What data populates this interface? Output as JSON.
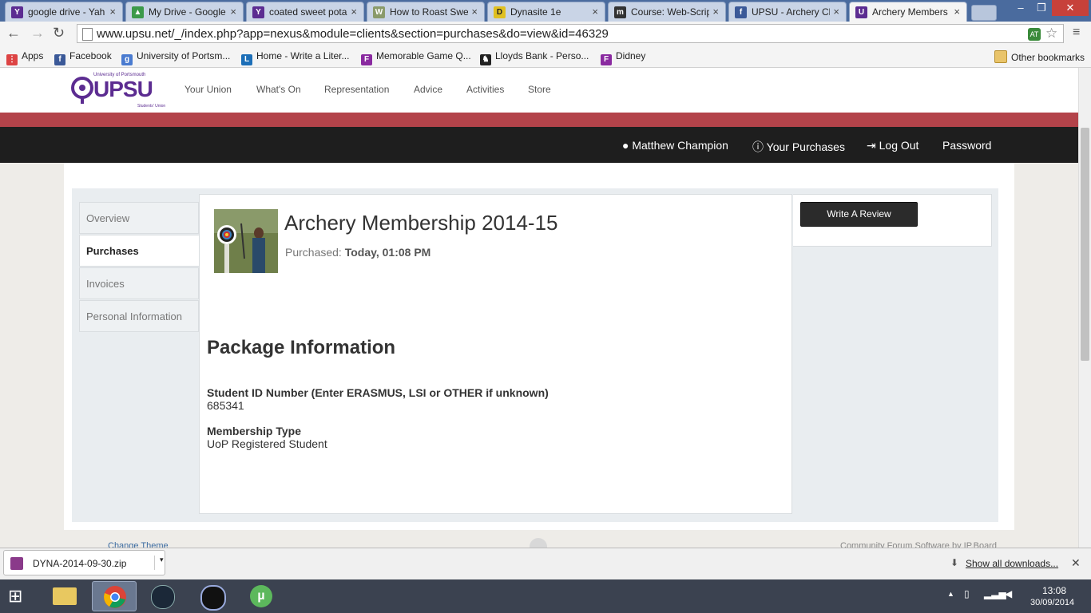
{
  "browser": {
    "tabs": [
      {
        "label": "google drive - Yah",
        "icon_letter": "Y",
        "icon_color": "#5c2c91"
      },
      {
        "label": "My Drive - Google",
        "icon_letter": "▲",
        "icon_color": "#3c9a4a"
      },
      {
        "label": "coated sweet pota",
        "icon_letter": "Y",
        "icon_color": "#5c2c91"
      },
      {
        "label": "How to Roast Swe",
        "icon_letter": "W",
        "icon_color": "#8a9a6a"
      },
      {
        "label": "Dynasite 1e",
        "icon_letter": "D",
        "icon_color": "#e0c020"
      },
      {
        "label": "Course: Web-Scrip",
        "icon_letter": "m",
        "icon_color": "#333333"
      },
      {
        "label": "UPSU - Archery Cl",
        "icon_letter": "f",
        "icon_color": "#3b5998"
      },
      {
        "label": "Archery Members",
        "icon_letter": "U",
        "icon_color": "#5c2c91"
      }
    ],
    "url": "www.upsu.net/_/index.php?app=nexus&module=clients&section=purchases&do=view&id=46329",
    "bookmarks": [
      {
        "label": "Apps",
        "icon_color": "#d44"
      },
      {
        "label": "Facebook",
        "icon_color": "#3b5998"
      },
      {
        "label": "University of Portsm...",
        "icon_color": "#4a7bd0"
      },
      {
        "label": "Home - Write a Liter...",
        "icon_color": "#1d6fb8"
      },
      {
        "label": "Memorable Game Q...",
        "icon_color": "#8a2aa0"
      },
      {
        "label": "Lloyds Bank - Perso...",
        "icon_color": "#222"
      },
      {
        "label": "Didney",
        "icon_color": "#8a2aa0"
      }
    ],
    "other_bookmarks": "Other bookmarks"
  },
  "site": {
    "logo": {
      "main": "UPSU",
      "top": "University of Portsmouth",
      "bottom": "Students' Union"
    },
    "nav": [
      "Your Union",
      "What's On",
      "Representation",
      "Advice",
      "Activities",
      "Store"
    ],
    "userbar": {
      "user": "Matthew Champion",
      "purchases": "Your Purchases",
      "logout": "Log Out",
      "password": "Password"
    },
    "colors": {
      "brand_purple": "#5c2c91",
      "red_bar": "#b3434a",
      "user_bar": "#1e1e1e"
    }
  },
  "sidenav": [
    "Overview",
    "Purchases",
    "Invoices",
    "Personal Information"
  ],
  "purchase": {
    "title": "Archery Membership 2014-15",
    "purchased_label": "Purchased:",
    "purchased_value": "Today, 01:08 PM",
    "package_heading": "Package Information",
    "fields": [
      {
        "label": "Student ID Number (Enter ERASMUS, LSI or OTHER if unknown)",
        "value": "685341"
      },
      {
        "label": "Membership Type",
        "value": "UoP Registered Student"
      }
    ],
    "review_button": "Write A Review"
  },
  "footer": {
    "left": "Change Theme",
    "right": "Community Forum Software by IP.Board"
  },
  "downloads": {
    "file": "DYNA-2014-09-30.zip",
    "show_all": "Show all downloads..."
  },
  "taskbar": {
    "time": "13:08",
    "date": "30/09/2014"
  }
}
